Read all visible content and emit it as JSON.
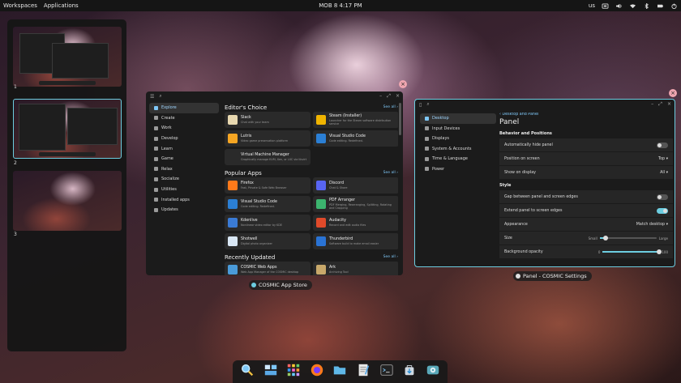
{
  "topbar": {
    "workspaces_label": "Workspaces",
    "applications_label": "Applications",
    "clock": "MOB 8 4:17 PM",
    "keyboard_layout": "us"
  },
  "workspaces": [
    {
      "number": "1"
    },
    {
      "number": "2"
    },
    {
      "number": "3"
    }
  ],
  "app_store": {
    "label": "COSMIC App Store",
    "nav": [
      {
        "label": "Explore",
        "active": true
      },
      {
        "label": "Create"
      },
      {
        "label": "Work"
      },
      {
        "label": "Develop"
      },
      {
        "label": "Learn"
      },
      {
        "label": "Game"
      },
      {
        "label": "Relax"
      },
      {
        "label": "Socialize"
      },
      {
        "label": "Utilities"
      },
      {
        "label": "Installed apps"
      },
      {
        "label": "Updates"
      }
    ],
    "see_all": "See all",
    "sections": [
      {
        "title": "Editor's Choice",
        "apps": [
          {
            "name": "Slack",
            "desc": "Chat with your team",
            "color": "#e8d8b0"
          },
          {
            "name": "Steam (Installer)",
            "desc": "Launcher for the Steam software distribution service",
            "color": "#f0b400"
          },
          {
            "name": "Lutris",
            "desc": "Video game preservation platform",
            "color": "#f6a623"
          },
          {
            "name": "Visual Studio Code",
            "desc": "Code editing. Redefined.",
            "color": "#2b7fd4"
          },
          {
            "name": "Virtual Machine Manager",
            "desc": "Graphically manage KVM, Xen, or LXC via libvirt",
            "color": "#2a2a2a"
          }
        ]
      },
      {
        "title": "Popular Apps",
        "apps": [
          {
            "name": "Firefox",
            "desc": "Fast, Private & Safe Web Browser",
            "color": "#ff7a1a"
          },
          {
            "name": "Discord",
            "desc": "Chat & Share",
            "color": "#5865f2"
          },
          {
            "name": "Visual Studio Code",
            "desc": "Code editing. Redefined.",
            "color": "#2b7fd4"
          },
          {
            "name": "PDF Arranger",
            "desc": "PDF Merging, Rearranging, Splitting, Rotating and Cropping",
            "color": "#3cb46e"
          },
          {
            "name": "Kdenlive",
            "desc": "Nonlinear video editor by KDE",
            "color": "#3a7bd5"
          },
          {
            "name": "Audacity",
            "desc": "Record and edit audio files",
            "color": "#e04a2a"
          },
          {
            "name": "Shotwell",
            "desc": "Digital photo organizer",
            "color": "#d9e7f5"
          },
          {
            "name": "Thunderbird",
            "desc": "Software build to make email easier",
            "color": "#2a73d4"
          }
        ]
      },
      {
        "title": "Recently Updated",
        "apps": [
          {
            "name": "COSMIC Web Apps",
            "desc": "Web App Manager of the COSMIC desktop",
            "color": "#4a9bd9"
          },
          {
            "name": "Ark",
            "desc": "Archiving Tool",
            "color": "#c8a86a"
          }
        ]
      }
    ]
  },
  "settings": {
    "label": "Panel - COSMIC Settings",
    "nav": [
      {
        "label": "Desktop",
        "active": true
      },
      {
        "label": "Input Devices"
      },
      {
        "label": "Displays"
      },
      {
        "label": "System & Accounts"
      },
      {
        "label": "Time & Language"
      },
      {
        "label": "Power"
      }
    ],
    "back_link": "Desktop and Panel",
    "page_title": "Panel",
    "groups": [
      {
        "title": "Behavior and Positions",
        "rows": [
          {
            "label": "Automatically hide panel",
            "type": "toggle",
            "on": false
          },
          {
            "label": "Position on screen",
            "type": "dropdown",
            "value": "Top"
          },
          {
            "label": "Show on display",
            "type": "dropdown",
            "value": "All"
          }
        ]
      },
      {
        "title": "Style",
        "rows": [
          {
            "label": "Gap between panel and screen edges",
            "type": "toggle",
            "on": false
          },
          {
            "label": "Extend panel to screen edges",
            "type": "toggle",
            "on": true
          },
          {
            "label": "Appearance",
            "type": "dropdown",
            "value": "Match desktop"
          },
          {
            "label": "Size",
            "type": "slider",
            "min_label": "Small",
            "max_label": "Large",
            "value": 0.1
          },
          {
            "label": "Background opacity",
            "type": "slider",
            "min_label": "0",
            "max_label": "100",
            "value": 1.0
          }
        ]
      }
    ]
  },
  "dock": [
    {
      "icon": "magnifier-icon"
    },
    {
      "icon": "workspaces-icon"
    },
    {
      "icon": "app-grid-icon"
    },
    {
      "icon": "firefox-icon"
    },
    {
      "icon": "files-icon"
    },
    {
      "icon": "text-editor-icon"
    },
    {
      "icon": "terminal-icon"
    },
    {
      "icon": "app-store-icon"
    },
    {
      "icon": "settings-icon"
    }
  ],
  "colors": {
    "accent": "#6ccde0",
    "link": "#7fc8f8"
  }
}
